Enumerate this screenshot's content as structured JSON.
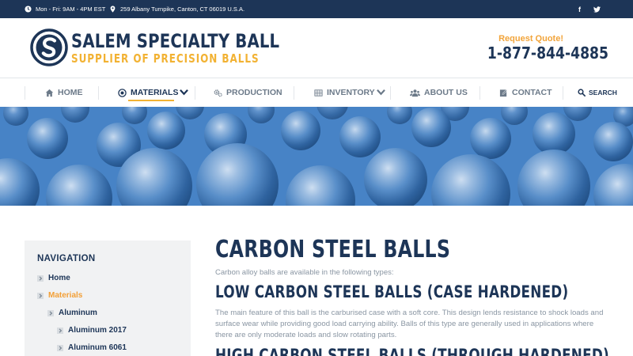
{
  "topbar": {
    "hours": "Mon - Fri: 9AM - 4PM EST",
    "address": "259 Albany Turnpike, Canton, CT 06019 U.S.A.",
    "social": {
      "facebook": "f",
      "twitter": "twitter-icon"
    }
  },
  "header": {
    "logo_name": "SALEM SPECIALTY BALL",
    "logo_tagline": "SUPPLIER OF PRECISION BALLS",
    "quote_label": "Request Quote!",
    "phone": "1-877-844-4885"
  },
  "nav": {
    "items": [
      {
        "label": "HOME",
        "icon": "home-icon"
      },
      {
        "label": "MATERIALS",
        "icon": "target-icon",
        "active": true,
        "dropdown": true
      },
      {
        "label": "PRODUCTION",
        "icon": "gears-icon"
      },
      {
        "label": "INVENTORY",
        "icon": "grid-icon",
        "dropdown": true
      },
      {
        "label": "ABOUT US",
        "icon": "users-icon"
      },
      {
        "label": "CONTACT",
        "icon": "edit-icon"
      }
    ],
    "search_label": "SEARCH"
  },
  "sidebar": {
    "title": "NAVIGATION",
    "links": [
      {
        "label": "Home"
      },
      {
        "label": "Materials",
        "active": true
      },
      {
        "label": "Aluminum"
      },
      {
        "label": "Aluminum 2017"
      },
      {
        "label": "Aluminum 6061"
      }
    ]
  },
  "main": {
    "title": "CARBON STEEL BALLS",
    "intro": "Carbon alloy balls are available in the following types:",
    "section1_title": "LOW CARBON STEEL BALLS (CASE HARDENED)",
    "section1_text": "The main feature of this ball is the carburised case with a soft core. This design lends resistance to shock loads and surface wear while providing good load carrying ability. Balls of this type are generally used in applications where there are only moderate loads and slow rotating parts.",
    "section2_title": "HIGH CARBON STEEL BALLS (THROUGH HARDENED)"
  },
  "colors": {
    "navy": "#1d3557",
    "gold": "#f2b233",
    "hero_blue": "#3f7fc4"
  }
}
